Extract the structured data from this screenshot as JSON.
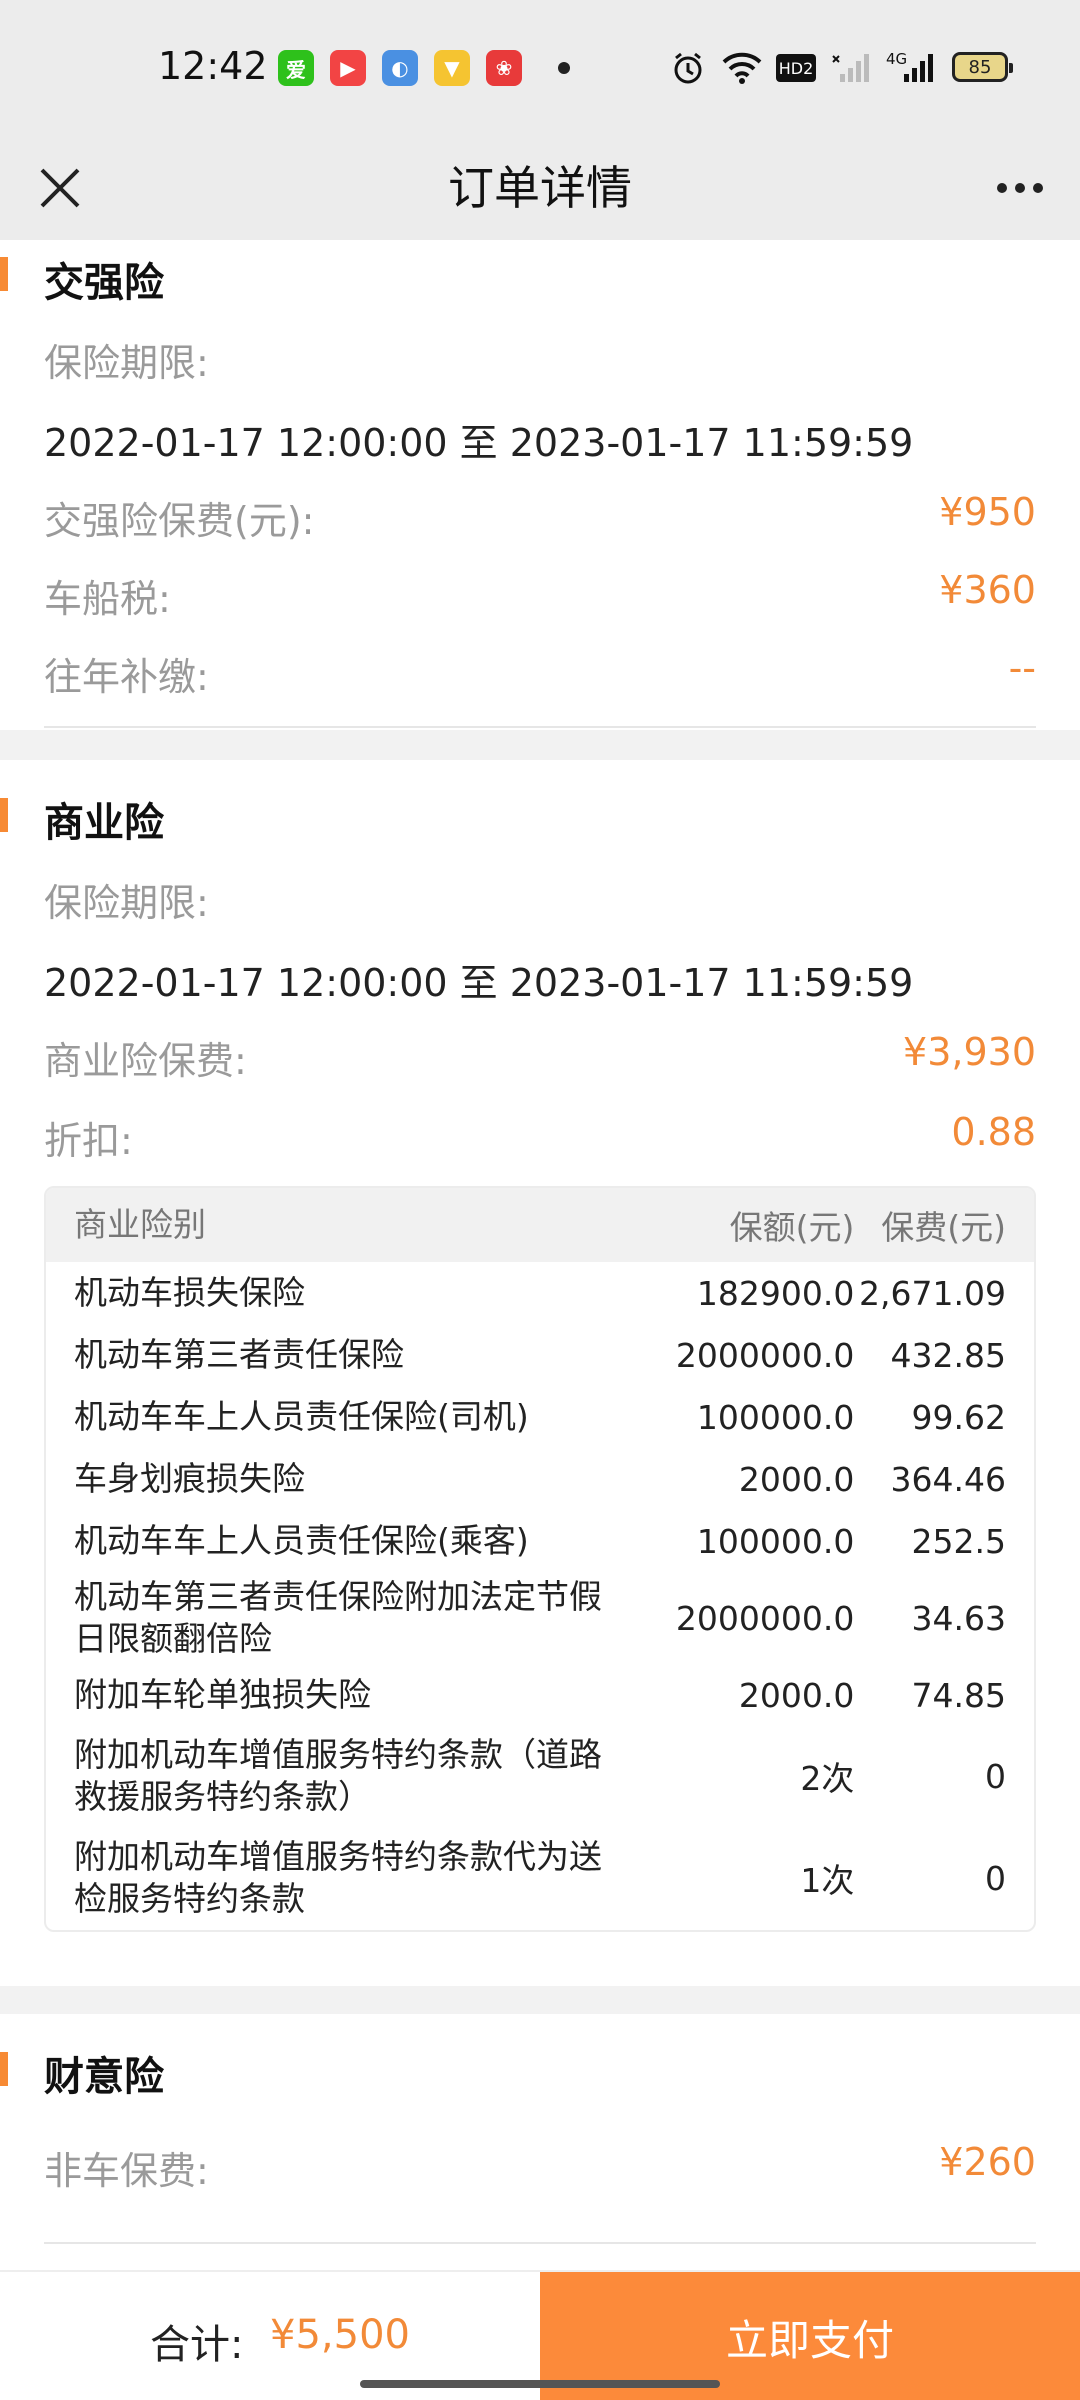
{
  "status_bar": {
    "time": "12:42",
    "apps": [
      {
        "name": "iqiyi-icon",
        "glyph": "爱",
        "color": "#2ec11b"
      },
      {
        "name": "video-app-icon",
        "glyph": "▶",
        "color": "#f24444"
      },
      {
        "name": "browser-icon",
        "glyph": "◐",
        "color": "#4a90e2"
      },
      {
        "name": "coupon-app-icon",
        "glyph": "▼",
        "color": "#f5c431"
      },
      {
        "name": "shopping-app-icon",
        "glyph": "❀",
        "color": "#e83a3a"
      }
    ],
    "network": "HD2",
    "signal": "4G",
    "battery": "85"
  },
  "nav": {
    "title": "订单详情"
  },
  "jqx": {
    "title": "交强险",
    "period_label": "保险期限:",
    "period_value": "2022-01-17 12:00:00 至 2023-01-17 11:59:59",
    "premium_label": "交强险保费(元):",
    "premium_value": "¥950",
    "tax_label": "车船税:",
    "tax_value": "¥360",
    "arrears_label": "往年补缴:",
    "arrears_value": "--"
  },
  "syx": {
    "title": "商业险",
    "period_label": "保险期限:",
    "period_value": "2022-01-17 12:00:00 至 2023-01-17 11:59:59",
    "premium_label": "商业险保费:",
    "premium_value": "¥3,930",
    "discount_label": "折扣:",
    "discount_value": "0.88",
    "table": {
      "headers": [
        "商业险别",
        "保额(元)",
        "保费(元)"
      ],
      "rows": [
        {
          "name": "机动车损失保险",
          "amount": "182900.0",
          "fee": "2,671.09"
        },
        {
          "name": "机动车第三者责任保险",
          "amount": "2000000.0",
          "fee": "432.85"
        },
        {
          "name": "机动车车上人员责任保险(司机)",
          "amount": "100000.0",
          "fee": "99.62"
        },
        {
          "name": "车身划痕损失险",
          "amount": "2000.0",
          "fee": "364.46"
        },
        {
          "name": "机动车车上人员责任保险(乘客)",
          "amount": "100000.0",
          "fee": "252.5"
        },
        {
          "name": "机动车第三者责任保险附加法定节假日限额翻倍险",
          "amount": "2000000.0",
          "fee": "34.63"
        },
        {
          "name": "附加车轮单独损失险",
          "amount": "2000.0",
          "fee": "74.85"
        },
        {
          "name": "附加机动车增值服务特约条款（道路救援服务特约条款）",
          "amount": "2次",
          "fee": "0"
        },
        {
          "name": "附加机动车增值服务特约条款代为送检服务特约条款",
          "amount": "1次",
          "fee": "0"
        }
      ]
    }
  },
  "cyx": {
    "title": "财意险",
    "premium_label": "非车保费:",
    "premium_value": "¥260"
  },
  "footer": {
    "total_label": "合计:",
    "total_value": "¥5,500",
    "pay_label": "立即支付"
  },
  "colors": {
    "accent": "#f28a38",
    "pay_button": "#fc8a3a"
  }
}
